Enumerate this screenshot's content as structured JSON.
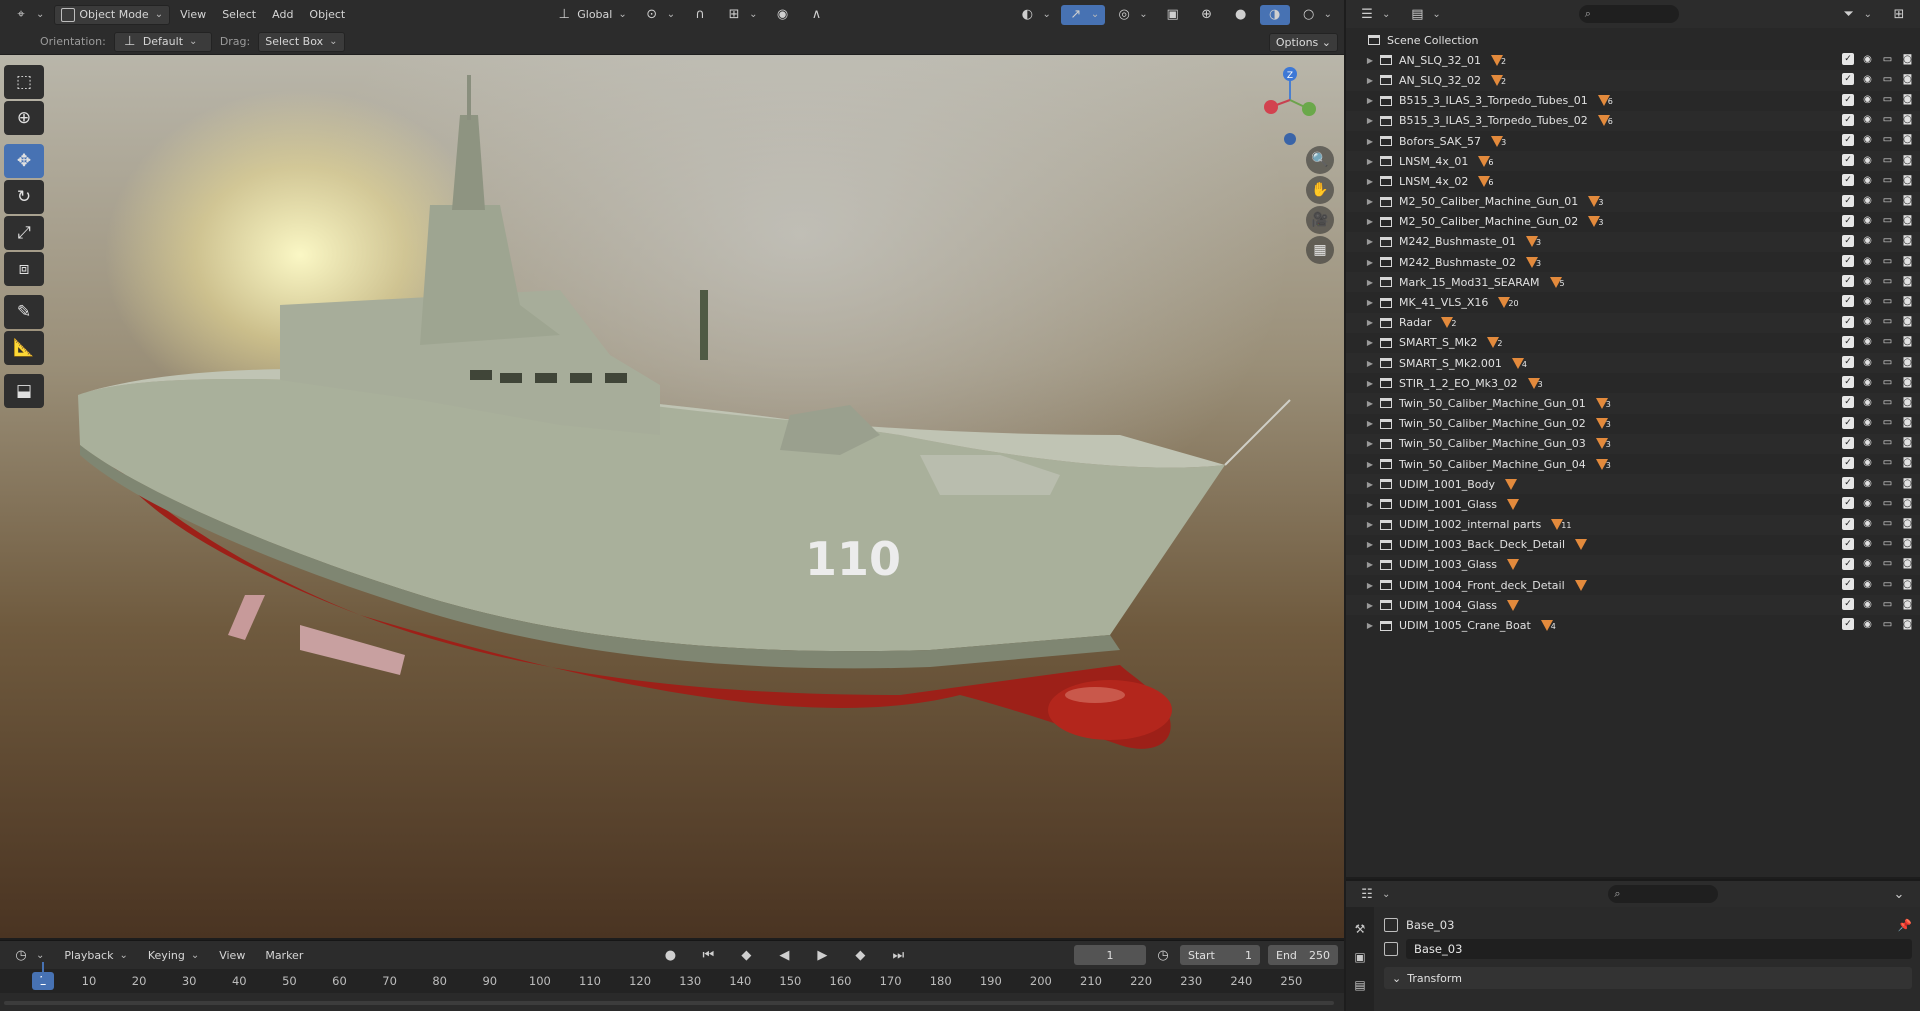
{
  "viewport": {
    "header": {
      "mode_label": "Object Mode",
      "menus": [
        "View",
        "Select",
        "Add",
        "Object"
      ],
      "transform_orientation": "Global"
    },
    "tool_settings": {
      "orientation_label": "Orientation:",
      "orientation_value": "Default",
      "drag_label": "Drag:",
      "drag_value": "Select Box",
      "options_label": "Options"
    },
    "hull_number": "110",
    "gizmo_axis": "Z"
  },
  "timeline": {
    "menus": [
      "Playback",
      "Keying",
      "View",
      "Marker"
    ],
    "current_frame": "1",
    "start_label": "Start",
    "start_value": "1",
    "end_label": "End",
    "end_value": "250",
    "ruler_current": "1",
    "ruler_ticks": [
      "10",
      "20",
      "30",
      "40",
      "50",
      "60",
      "70",
      "80",
      "90",
      "100",
      "110",
      "120",
      "130",
      "140",
      "150",
      "160",
      "170",
      "180",
      "190",
      "200",
      "210",
      "220",
      "230",
      "240",
      "250"
    ]
  },
  "outliner": {
    "root_label": "Scene Collection",
    "items": [
      {
        "name": "AN_SLQ_32_01",
        "count": "2"
      },
      {
        "name": "AN_SLQ_32_02",
        "count": "2"
      },
      {
        "name": "B515_3_ILAS_3_Torpedo_Tubes_01",
        "count": "6"
      },
      {
        "name": "B515_3_ILAS_3_Torpedo_Tubes_02",
        "count": "6"
      },
      {
        "name": "Bofors_SAK_57",
        "count": "3"
      },
      {
        "name": "LNSM_4x_01",
        "count": "6"
      },
      {
        "name": "LNSM_4x_02",
        "count": "6"
      },
      {
        "name": "M2_50_Caliber_Machine_Gun_01",
        "count": "3"
      },
      {
        "name": "M2_50_Caliber_Machine_Gun_02",
        "count": "3"
      },
      {
        "name": "M242_Bushmaste_01",
        "count": "3"
      },
      {
        "name": "M242_Bushmaste_02",
        "count": "3"
      },
      {
        "name": "Mark_15_Mod31_SEARAM",
        "count": "5"
      },
      {
        "name": "MK_41_VLS_X16",
        "count": "20"
      },
      {
        "name": "Radar",
        "count": "2"
      },
      {
        "name": "SMART_S_Mk2",
        "count": "2"
      },
      {
        "name": "SMART_S_Mk2.001",
        "count": "4"
      },
      {
        "name": "STIR_1_2_EO_Mk3_02",
        "count": "3"
      },
      {
        "name": "Twin_50_Caliber_Machine_Gun_01",
        "count": "3"
      },
      {
        "name": "Twin_50_Caliber_Machine_Gun_02",
        "count": "3"
      },
      {
        "name": "Twin_50_Caliber_Machine_Gun_03",
        "count": "3"
      },
      {
        "name": "Twin_50_Caliber_Machine_Gun_04",
        "count": "3"
      },
      {
        "name": "UDIM_1001_Body",
        "count": ""
      },
      {
        "name": "UDIM_1001_Glass",
        "count": ""
      },
      {
        "name": "UDIM_1002_internal parts",
        "count": "11"
      },
      {
        "name": "UDIM_1003_Back_Deck_Detail",
        "count": ""
      },
      {
        "name": "UDIM_1003_Glass",
        "count": ""
      },
      {
        "name": "UDIM_1004_Front_deck_Detail",
        "count": ""
      },
      {
        "name": "UDIM_1004_Glass",
        "count": ""
      },
      {
        "name": "UDIM_1005_Crane_Boat",
        "count": "4"
      }
    ]
  },
  "properties": {
    "context_name": "Base_03",
    "object_name": "Base_03",
    "panel_title": "Transform"
  },
  "colors": {
    "accent": "#4772b3",
    "mesh_icon": "#e38a3c",
    "hull_green": "#a9b09b",
    "hull_red": "#b0241c"
  }
}
